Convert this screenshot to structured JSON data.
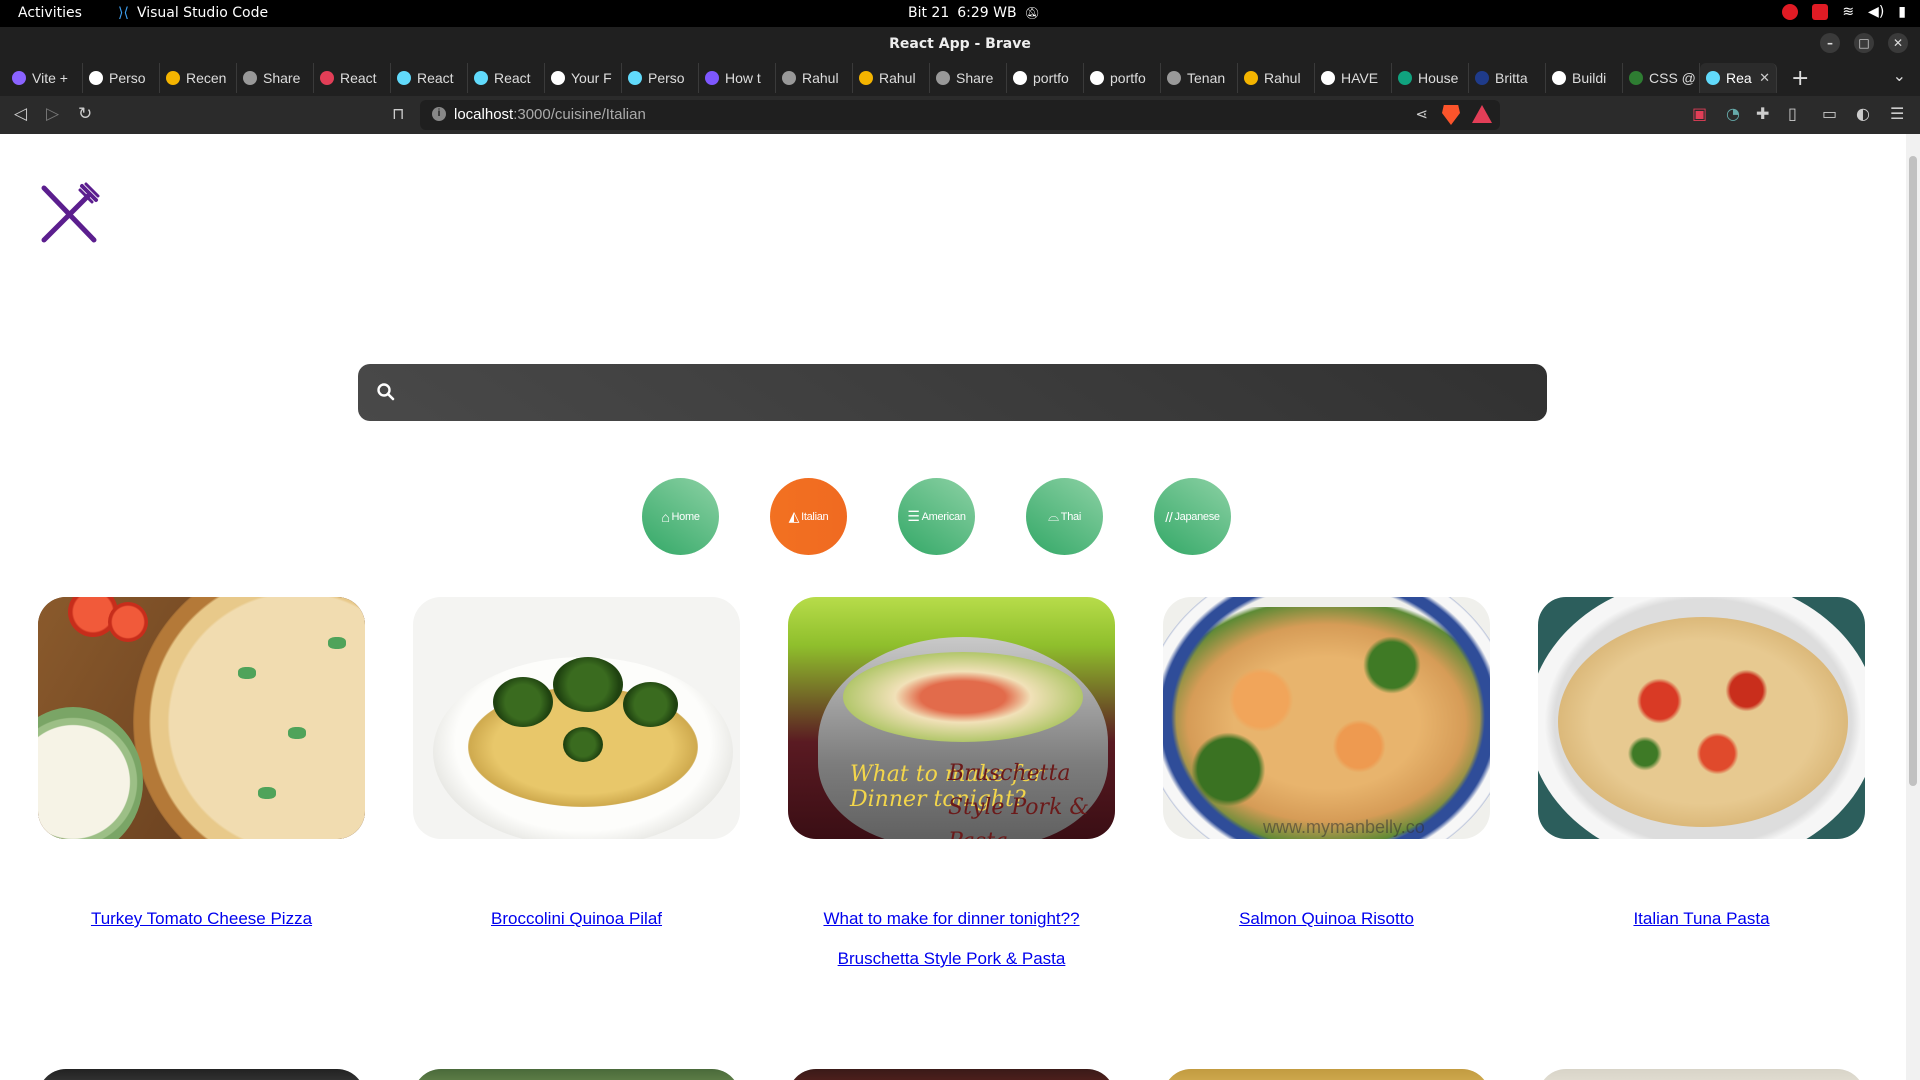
{
  "system": {
    "activities": "Activities",
    "app_name": "Visual Studio Code",
    "date": "Bit 21",
    "time": "6:29 WB"
  },
  "window": {
    "title": "React App - Brave"
  },
  "tabs": [
    {
      "label": "Vite +",
      "color": "#8a63ff"
    },
    {
      "label": "Perso",
      "color": "#ffffff"
    },
    {
      "label": "Recen",
      "color": "#f4b400"
    },
    {
      "label": "Share",
      "color": "#999999"
    },
    {
      "label": "React",
      "color": "#e23e57"
    },
    {
      "label": "React",
      "color": "#61dafb"
    },
    {
      "label": "React",
      "color": "#61dafb"
    },
    {
      "label": "Your F",
      "color": "#ffffff"
    },
    {
      "label": "Perso",
      "color": "#61dafb"
    },
    {
      "label": "How t",
      "color": "#7e57ff"
    },
    {
      "label": "Rahul",
      "color": "#999999"
    },
    {
      "label": "Rahul",
      "color": "#f4b400"
    },
    {
      "label": "Share",
      "color": "#999999"
    },
    {
      "label": "portfo",
      "color": "#ffffff"
    },
    {
      "label": "portfo",
      "color": "#ffffff"
    },
    {
      "label": "Tenan",
      "color": "#999999"
    },
    {
      "label": "Rahul",
      "color": "#f4b400"
    },
    {
      "label": "HAVE",
      "color": "#ffffff"
    },
    {
      "label": "House",
      "color": "#10a37f"
    },
    {
      "label": "Britta",
      "color": "#1f3b8a"
    },
    {
      "label": "Buildi",
      "color": "#ffffff"
    },
    {
      "label": "CSS @",
      "color": "#2e7d32"
    },
    {
      "label": "Rea",
      "color": "#61dafb",
      "active": true
    }
  ],
  "address_bar": {
    "url_host": "localhost",
    "url_rest": ":3000/cuisine/Italian"
  },
  "page": {
    "search": {
      "placeholder": "",
      "value": ""
    },
    "categories": [
      {
        "label": "Home",
        "icon": "home-icon",
        "glyph": "⌂",
        "active": false
      },
      {
        "label": "Italian",
        "icon": "pizza-icon",
        "glyph": "◭",
        "active": true
      },
      {
        "label": "American",
        "icon": "burger-icon",
        "glyph": "☰",
        "active": false
      },
      {
        "label": "Thai",
        "icon": "noodle-bowl-icon",
        "glyph": "⌓",
        "active": false
      },
      {
        "label": "Japanese",
        "icon": "chopsticks-icon",
        "glyph": "//",
        "active": false
      }
    ],
    "recipes": [
      {
        "title": "Turkey Tomato Cheese Pizza",
        "image": "pizza"
      },
      {
        "title": "Broccolini Quinoa Pilaf",
        "image": "quinoa"
      },
      {
        "title": "What to make for dinner tonight?? Bruschetta Style Pork & Pasta",
        "image": "bowl",
        "image_text_1": "What to make for Dinner tonight?",
        "image_text_2": "Bruschetta Style Pork & Pasta"
      },
      {
        "title": "Salmon Quinoa Risotto",
        "image": "risotto",
        "image_text": "www.mymanbelly.co"
      },
      {
        "title": "Italian Tuna Pasta",
        "image": "pasta"
      }
    ]
  },
  "colors": {
    "logo": "#5b1e8e",
    "category_green_start": "#33a867",
    "category_active": "#f27121",
    "link": "#0000ee",
    "search_bg": "#3f3f3f"
  }
}
